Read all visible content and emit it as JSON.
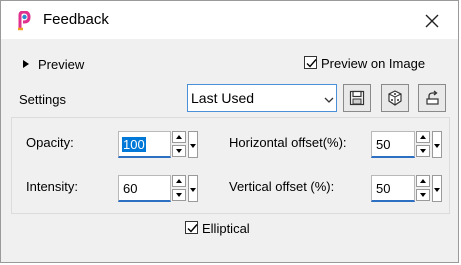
{
  "window": {
    "title": "Feedback"
  },
  "preview_toggle": {
    "label": "Preview"
  },
  "preview_on_image": {
    "label": "Preview on Image",
    "checked": true
  },
  "settings": {
    "label": "Settings",
    "preset_value": "Last Used"
  },
  "fields": {
    "opacity": {
      "label": "Opacity:",
      "value": "100"
    },
    "intensity": {
      "label": "Intensity:",
      "value": "60"
    },
    "horizontal_offset": {
      "label": "Horizontal offset(%):",
      "value": "50"
    },
    "vertical_offset": {
      "label": "Vertical offset (%):",
      "value": "50"
    }
  },
  "elliptical": {
    "label": "Elliptical",
    "checked": true
  },
  "colors": {
    "accent": "#2d6fc2",
    "selection": "#0078d7",
    "panel_bg": "#f0f0f0"
  }
}
